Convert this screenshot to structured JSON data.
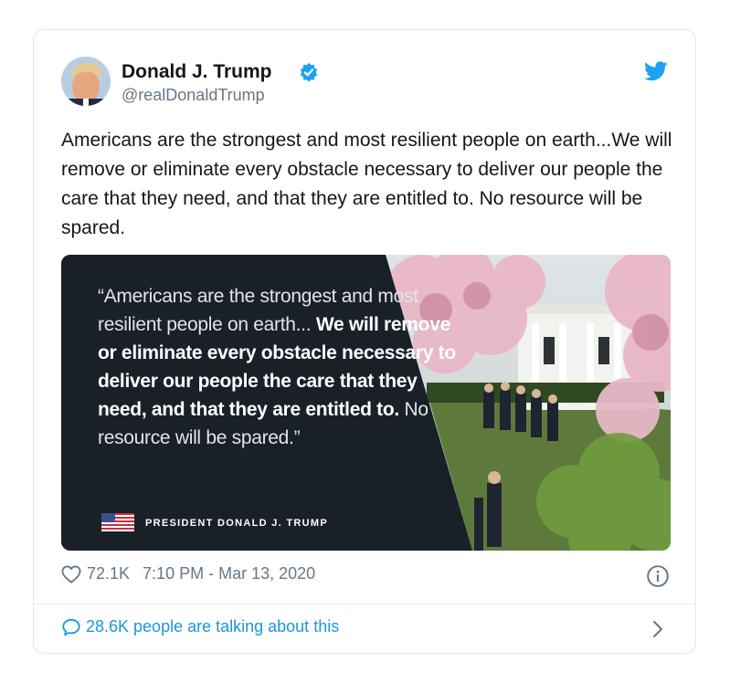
{
  "tweet": {
    "author_name": "Donald J. Trump",
    "handle": "@realDonaldTrump",
    "text": "Americans are the strongest and most resilient people on earth...We will remove or eliminate every obstacle necessary to deliver our people the care that they need, and that they are entitled to. No resource will be spared.",
    "likes": "72.1K",
    "time": "7:10 PM - Mar 13, 2020",
    "talking": "28.6K people are talking about this"
  },
  "media": {
    "quote_open": "“Americans are the strongest and most resilient people on earth...",
    "quote_bold": "We will remove or eliminate every obstacle necessary to deliver our people the care that they need, and that they are entitled to.",
    "quote_close": " No resource will be spared.”",
    "caption": "PRESIDENT DONALD J. TRUMP"
  },
  "icons": {
    "verified": "verified-badge-icon",
    "logo": "twitter-bird-icon",
    "like": "heart-icon",
    "info": "info-icon",
    "reply": "speech-bubble-icon",
    "chevron": "chevron-right-icon"
  },
  "colors": {
    "accent": "#1da1f2",
    "link": "#1b95e0",
    "meta": "#657786",
    "media_bg": "#1a2028"
  }
}
